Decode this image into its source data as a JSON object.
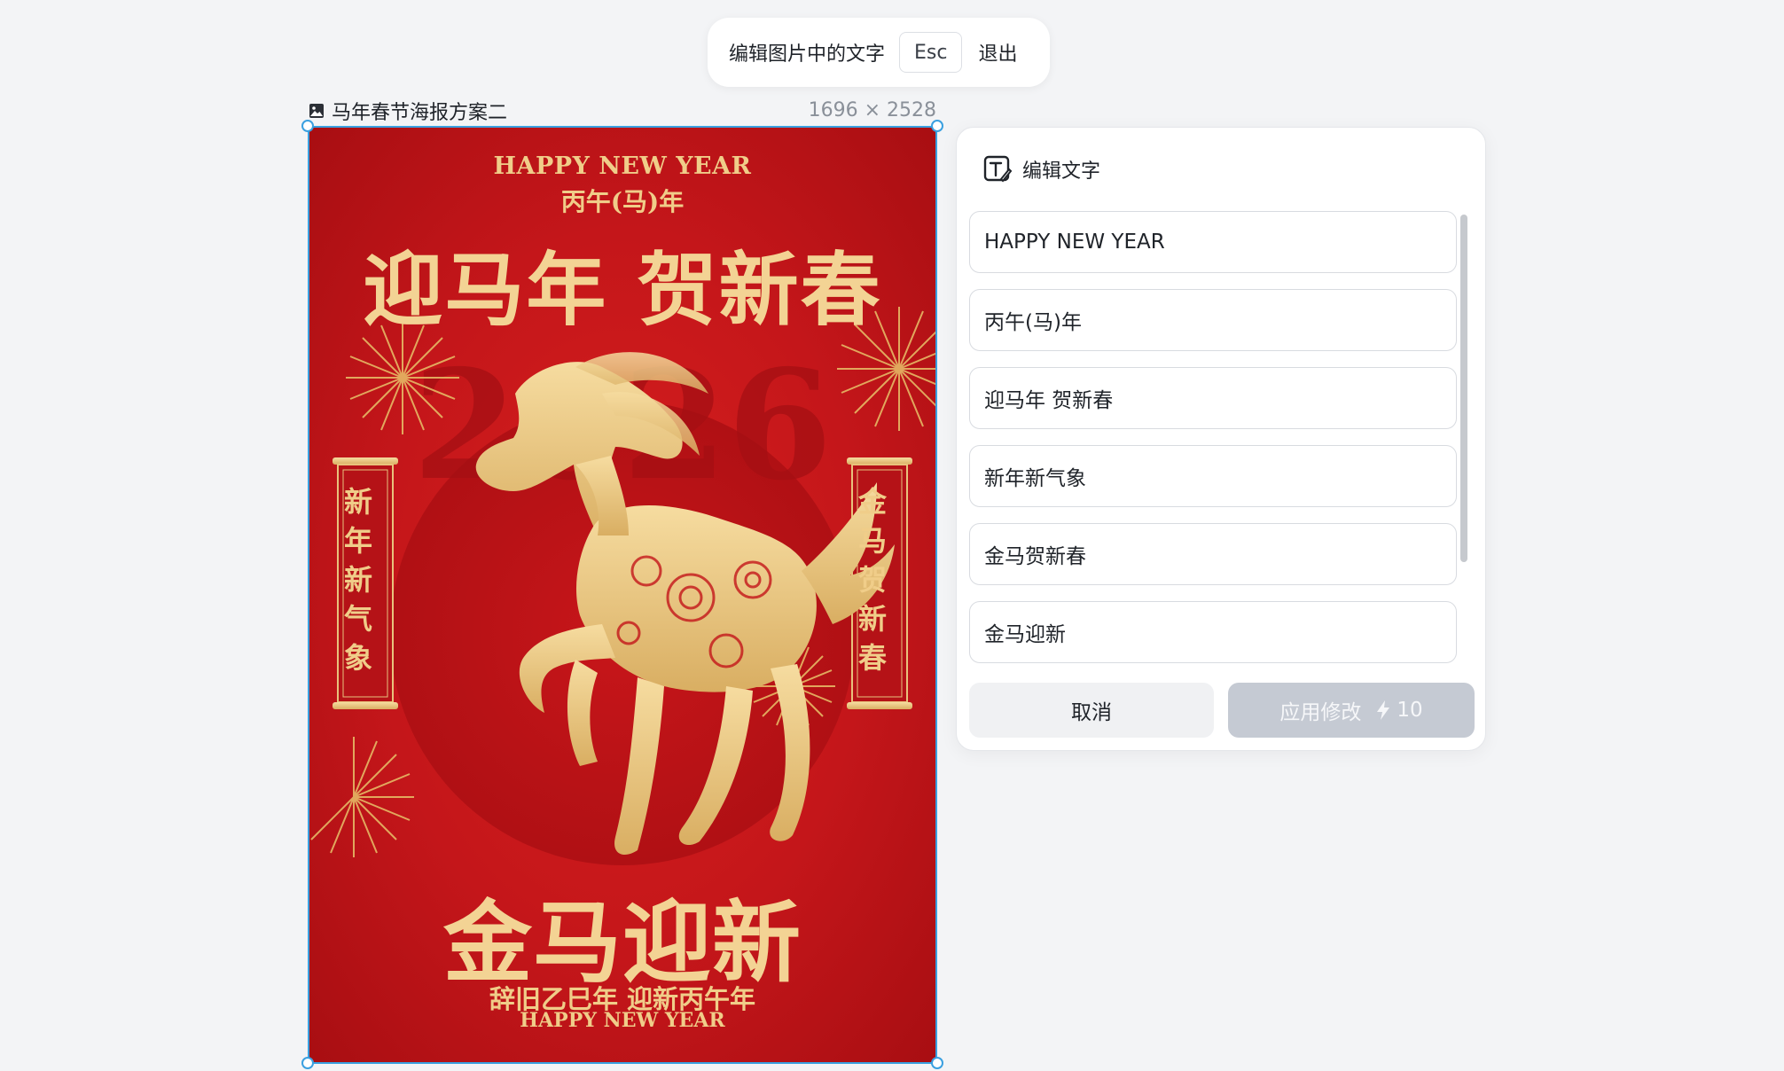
{
  "toolbar": {
    "hint": "编辑图片中的文字",
    "esc_key": "Esc",
    "exit_label": "退出"
  },
  "image": {
    "title": "马年春节海报方案二",
    "size": "1696 × 2528"
  },
  "poster": {
    "top_en": "HAPPY NEW YEAR",
    "top_cn": "丙午(马)年",
    "headline": "迎马年 贺新春",
    "watermark_year": "2026",
    "left_scroll": "新年新气象",
    "right_scroll": "金马贺新春",
    "bottom_headline": "金马迎新",
    "bottom_line": "辞旧乙巳年 迎新丙午年",
    "bottom_en": "HAPPY NEW YEAR"
  },
  "panel": {
    "title": "编辑文字",
    "fields": [
      "HAPPY NEW YEAR",
      "丙午(马)年",
      "迎马年 贺新春",
      "新年新气象",
      "金马贺新春",
      "金马迎新"
    ],
    "cancel_label": "取消",
    "apply_label": "应用修改",
    "apply_cost": "10"
  },
  "colors": {
    "accent": "#3aa0e0",
    "poster_red": "#c4161a",
    "gold": "#f0cd89",
    "apply_disabled": "#c5cad3"
  }
}
